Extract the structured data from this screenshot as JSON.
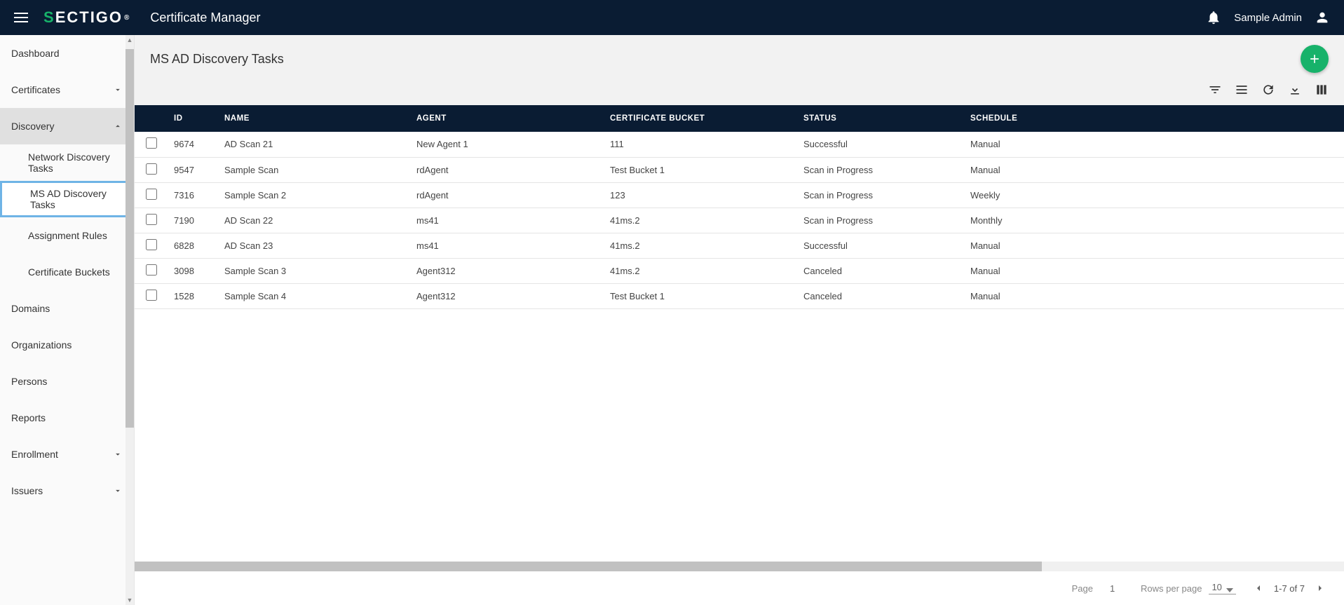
{
  "header": {
    "app_title": "Certificate Manager",
    "logo_text": "SECTIGO",
    "user_name": "Sample Admin"
  },
  "sidebar": {
    "items": [
      {
        "label": "Dashboard",
        "expandable": false
      },
      {
        "label": "Certificates",
        "expandable": true,
        "expanded": false
      },
      {
        "label": "Discovery",
        "expandable": true,
        "expanded": true,
        "children": [
          {
            "label": "Network Discovery Tasks",
            "active": false
          },
          {
            "label": "MS AD Discovery Tasks",
            "active": true
          },
          {
            "label": "Assignment Rules",
            "active": false
          },
          {
            "label": "Certificate Buckets",
            "active": false
          }
        ]
      },
      {
        "label": "Domains",
        "expandable": false
      },
      {
        "label": "Organizations",
        "expandable": false
      },
      {
        "label": "Persons",
        "expandable": false
      },
      {
        "label": "Reports",
        "expandable": false
      },
      {
        "label": "Enrollment",
        "expandable": true,
        "expanded": false
      },
      {
        "label": "Issuers",
        "expandable": true,
        "expanded": false
      }
    ]
  },
  "page": {
    "title": "MS AD Discovery Tasks"
  },
  "table": {
    "columns": [
      "ID",
      "NAME",
      "AGENT",
      "CERTIFICATE BUCKET",
      "STATUS",
      "SCHEDULE"
    ],
    "rows": [
      {
        "id": "9674",
        "name": "AD Scan 21",
        "agent": "New Agent 1",
        "bucket": "111",
        "status": "Successful",
        "schedule": "Manual"
      },
      {
        "id": "9547",
        "name": "Sample Scan",
        "agent": "rdAgent",
        "bucket": "Test Bucket 1",
        "status": "Scan in Progress",
        "schedule": "Manual"
      },
      {
        "id": "7316",
        "name": "Sample Scan 2",
        "agent": "rdAgent",
        "bucket": "123",
        "status": "Scan in Progress",
        "schedule": "Weekly"
      },
      {
        "id": "7190",
        "name": "AD Scan 22",
        "agent": "ms41",
        "bucket": "41ms.2",
        "status": "Scan in Progress",
        "schedule": "Monthly"
      },
      {
        "id": "6828",
        "name": "AD Scan 23",
        "agent": "ms41",
        "bucket": "41ms.2",
        "status": "Successful",
        "schedule": "Manual"
      },
      {
        "id": "3098",
        "name": "Sample Scan 3",
        "agent": "Agent312",
        "bucket": "41ms.2",
        "status": "Canceled",
        "schedule": "Manual"
      },
      {
        "id": "1528",
        "name": "Sample Scan 4",
        "agent": "Agent312",
        "bucket": "Test Bucket 1",
        "status": "Canceled",
        "schedule": "Manual"
      }
    ]
  },
  "pagination": {
    "page_label": "Page",
    "page": "1",
    "rows_label": "Rows per page",
    "rows_per_page": "10",
    "range": "1-7 of 7"
  }
}
